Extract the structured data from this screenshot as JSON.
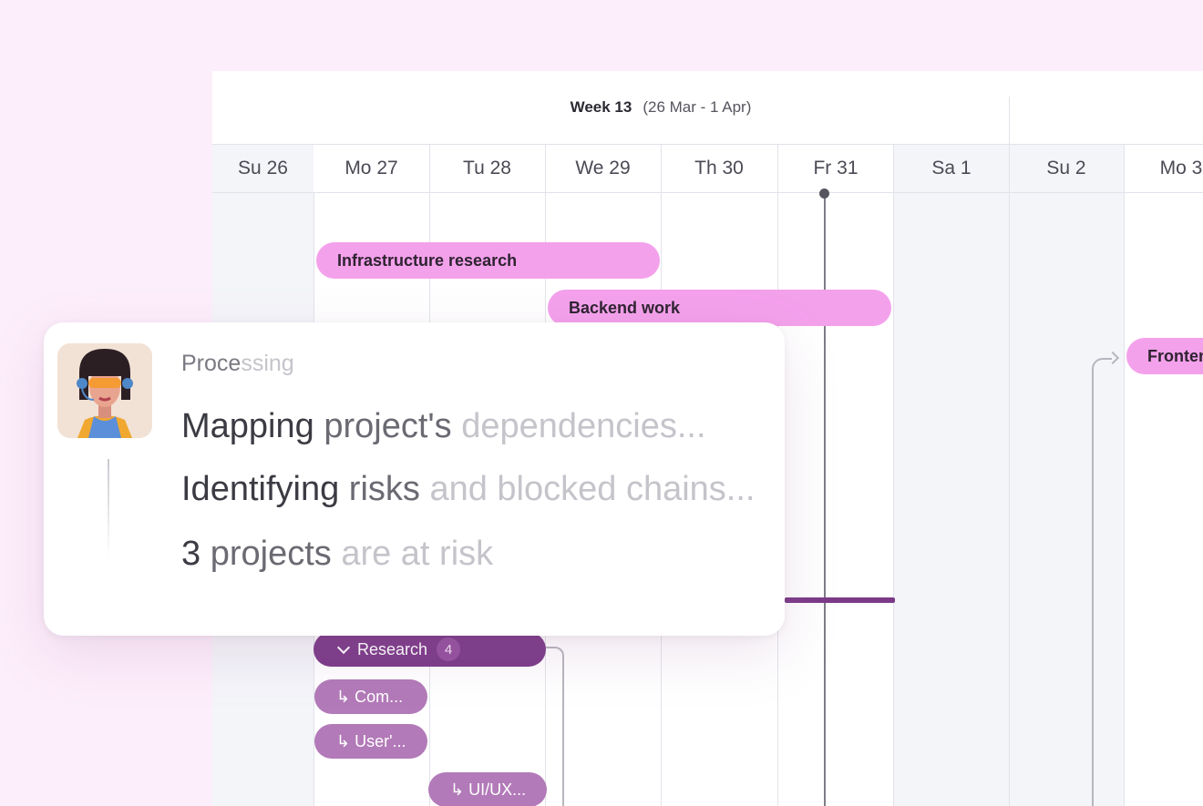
{
  "gantt": {
    "week": {
      "title": "Week 13",
      "range": "(26 Mar - 1 Apr)"
    },
    "days": [
      {
        "label": "Su 26",
        "weekend": true
      },
      {
        "label": "Mo 27",
        "weekend": false
      },
      {
        "label": "Tu 28",
        "weekend": false
      },
      {
        "label": "We 29",
        "weekend": false
      },
      {
        "label": "Th 30",
        "weekend": false
      },
      {
        "label": "Fr 31",
        "weekend": false
      },
      {
        "label": "Sa 1",
        "weekend": true
      },
      {
        "label": "Su 2",
        "weekend": true
      },
      {
        "label": "Mo 3",
        "weekend": false
      }
    ],
    "tasks": {
      "infrastructure": "Infrastructure research",
      "backend": "Backend work",
      "frontend": "Frontend"
    },
    "group": {
      "label": "Research",
      "count": "4"
    },
    "subtasks": {
      "com": "↳ Com...",
      "user": "↳ User'...",
      "uiux": "↳ UI/UX..."
    }
  },
  "assistant": {
    "status": {
      "strong": "Proce",
      "faded": "ssing"
    },
    "steps": {
      "mapping": {
        "a": "Mapping",
        "b": " project's",
        "c": " dependencies..."
      },
      "identifying": {
        "a": "Identifying",
        "b": " risks",
        "c": " and blocked chains..."
      },
      "result": {
        "a": "3",
        "b": " projects",
        "c": " are at risk"
      }
    },
    "avatar_icon": "assistant-avatar"
  },
  "colors": {
    "task_pink": "#f4a1ec",
    "group_purple": "#7b3a88",
    "subtask_purple": "#b27ab8",
    "background": "#fdeefb"
  }
}
